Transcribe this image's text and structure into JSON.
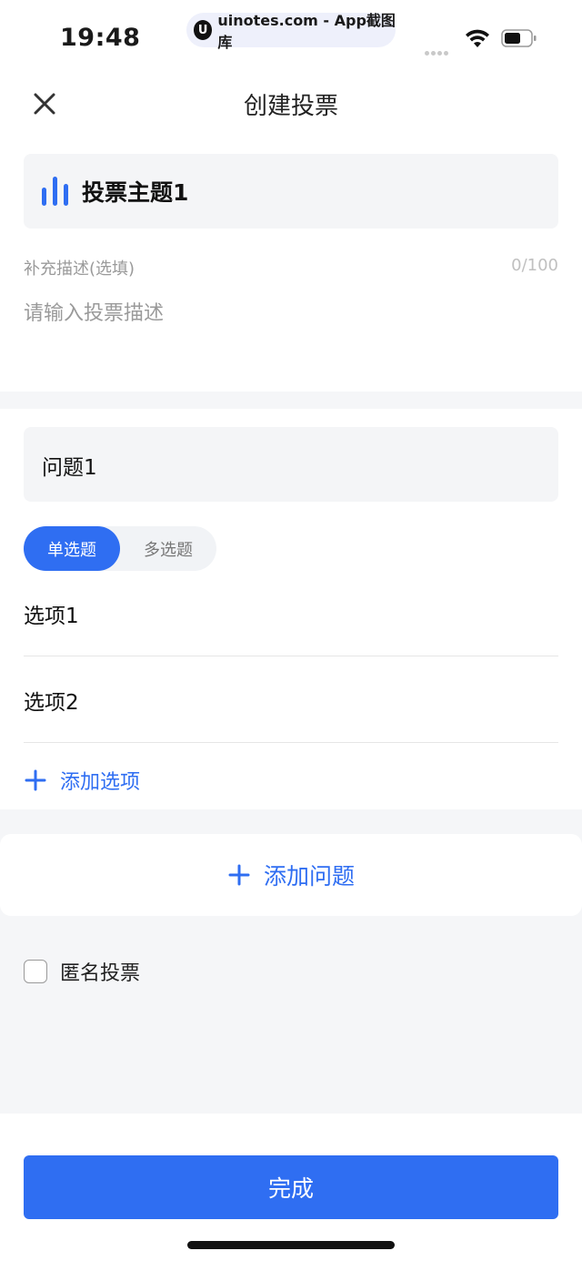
{
  "status": {
    "time": "19:48",
    "watermark": "uinotes.com - App截图库",
    "watermark_logo": "U"
  },
  "nav": {
    "title": "创建投票"
  },
  "topic": {
    "title": "投票主题1"
  },
  "description": {
    "label": "补充描述(选填)",
    "count": "0/100",
    "placeholder": "请输入投票描述"
  },
  "question": {
    "title": "问题1",
    "types": {
      "single": "单选题",
      "multi": "多选题"
    },
    "options": [
      "选项1",
      "选项2"
    ],
    "add_option": "添加选项"
  },
  "add_question": "添加问题",
  "anonymous": {
    "label": "匿名投票",
    "checked": false
  },
  "done": "完成",
  "colors": {
    "accent": "#2f6ef2",
    "background": "#f5f6f8"
  }
}
